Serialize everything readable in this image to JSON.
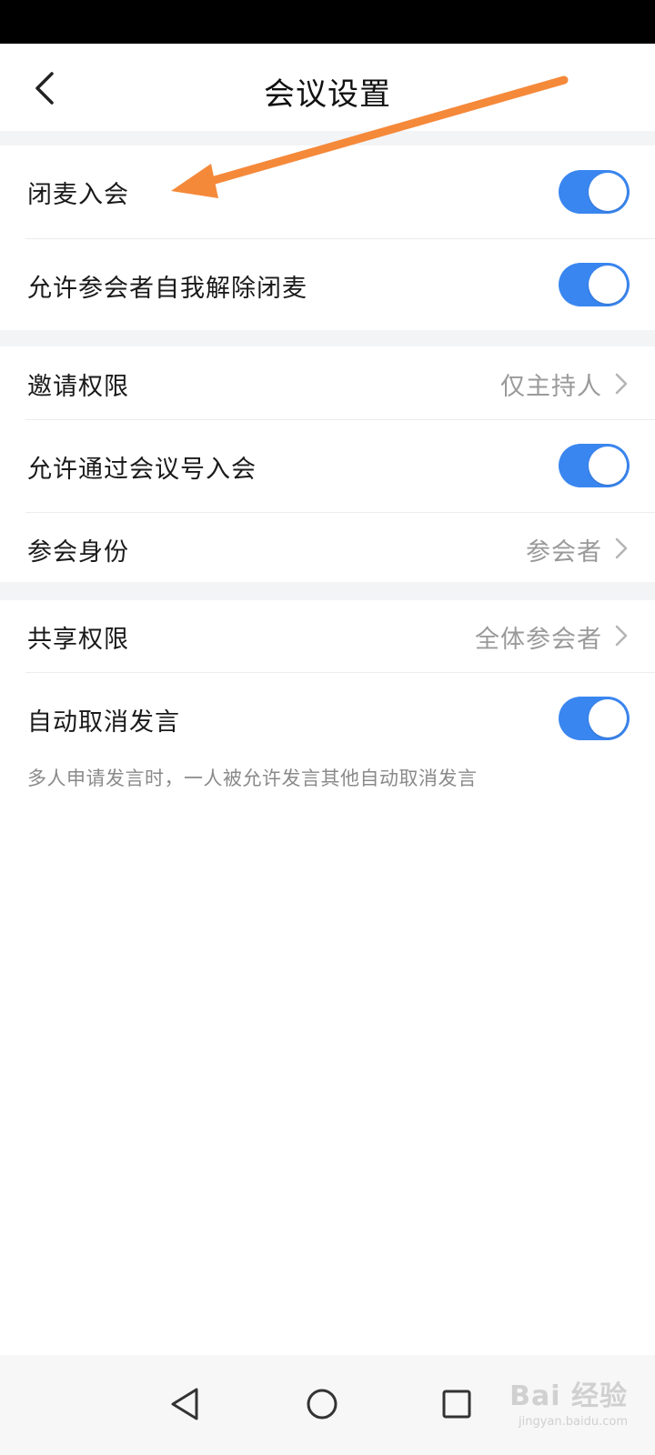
{
  "header": {
    "title": "会议设置",
    "back_icon": "chevron-left-icon"
  },
  "settings": {
    "mute_on_join": {
      "label": "闭麦入会",
      "enabled": true
    },
    "allow_self_unmute": {
      "label": "允许参会者自我解除闭麦",
      "enabled": true
    },
    "invite_permission": {
      "label": "邀请权限",
      "value": "仅主持人"
    },
    "allow_join_by_id": {
      "label": "允许通过会议号入会",
      "enabled": true
    },
    "participant_role": {
      "label": "参会身份",
      "value": "参会者"
    },
    "share_permission": {
      "label": "共享权限",
      "value": "全体参会者"
    },
    "auto_cancel_speaking": {
      "label": "自动取消发言",
      "enabled": true,
      "hint": "多人申请发言时，一人被允许发言其他自动取消发言"
    }
  },
  "system_nav": {
    "back_icon": "triangle-back-icon",
    "home_icon": "circle-home-icon",
    "recents_icon": "square-recents-icon"
  },
  "watermark": {
    "main": "Bai 经验",
    "sub": "jingyan.baidu.com"
  },
  "colors": {
    "toggle_on": "#3a86f0",
    "annotation_arrow": "#f5893a",
    "section_gap": "#f3f4f6"
  }
}
